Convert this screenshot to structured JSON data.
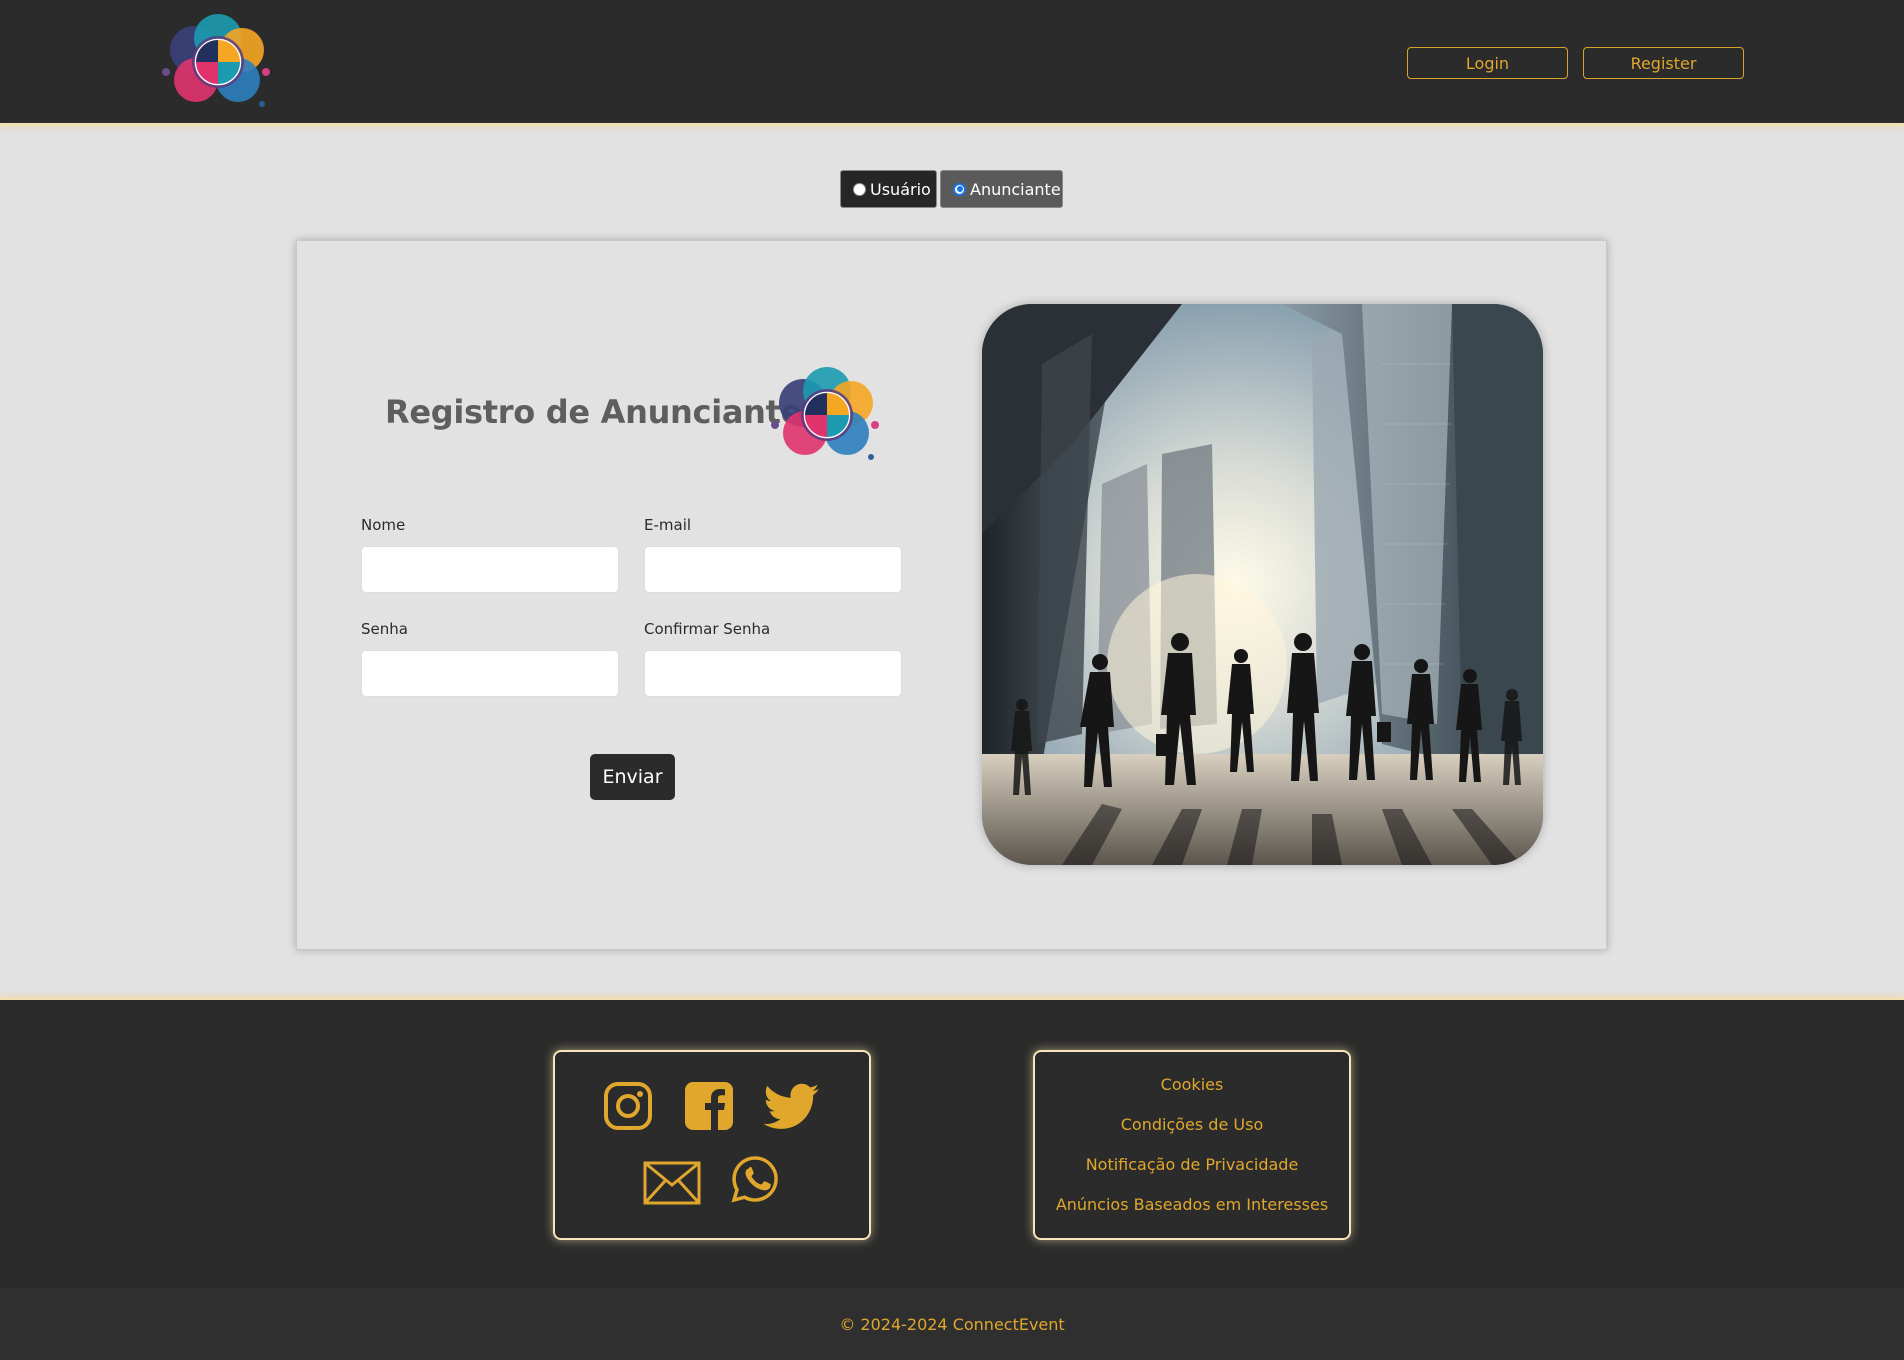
{
  "header": {
    "login_label": "Login",
    "register_label": "Register"
  },
  "role_toggle": {
    "options": [
      {
        "label": "Usuário",
        "selected": false
      },
      {
        "label": "Anunciante",
        "selected": true
      }
    ]
  },
  "form": {
    "title": "Registro de Anunciante",
    "fields": {
      "name": {
        "label": "Nome",
        "value": ""
      },
      "email": {
        "label": "E-mail",
        "value": ""
      },
      "password": {
        "label": "Senha",
        "value": ""
      },
      "confirm_password": {
        "label": "Confirmar Senha",
        "value": ""
      }
    },
    "submit_label": "Enviar"
  },
  "footer": {
    "social_icons": [
      "instagram-icon",
      "facebook-icon",
      "twitter-icon",
      "email-icon",
      "whatsapp-icon"
    ],
    "links": [
      "Cookies",
      "Condições de Uso",
      "Notificação de Privacidade",
      "Anúncios Baseados em Interesses"
    ],
    "copyright": "© 2024-2024 ConnectEvent"
  },
  "colors": {
    "header_bg": "#2b2b2b",
    "accent": "#e0a72c",
    "glow": "#f1dfb6",
    "page_bg": "#e2e2e2"
  }
}
